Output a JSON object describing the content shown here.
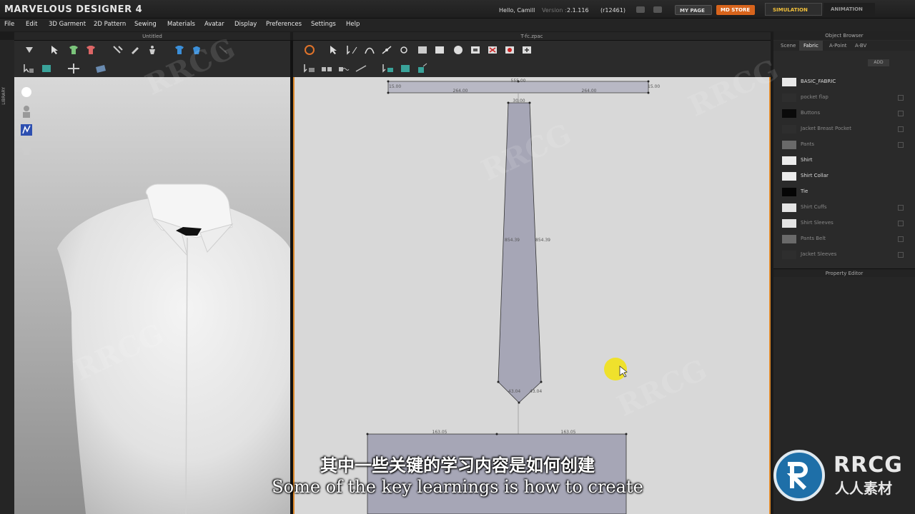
{
  "app": {
    "title": "MARVELOUS DESIGNER 4",
    "greeting": "Hello, Camill",
    "version_label": "Version :",
    "version": "2.1.116",
    "build": "(r12461)",
    "my_page": "MY PAGE",
    "md_store": "MD STORE",
    "simulation": "SIMULATION",
    "animation": "ANIMATION"
  },
  "menu": [
    "File",
    "Edit",
    "3D Garment",
    "2D Pattern",
    "Sewing",
    "Materials",
    "Avatar",
    "Display",
    "Preferences",
    "Settings",
    "Help"
  ],
  "left_strip_label": "LIBRARY",
  "view3d": {
    "title": "Untitled"
  },
  "view2d": {
    "title": "T-fc.zpac",
    "measurements": {
      "top_center": "555.00",
      "top_left_end": "15.00",
      "top_right_end": "15.00",
      "top_left": "264.00",
      "top_right": "264.00",
      "tie_top": "30.00",
      "tie_left": "854.39",
      "tie_right": "854.39",
      "tie_bottom_left": "43.04",
      "tie_bottom_right": "43.04",
      "bottom_left": "163.05",
      "bottom_right": "163.05"
    }
  },
  "object_browser": {
    "title": "Object Browser",
    "tabs": [
      "Scene",
      "Fabric",
      "A-Point",
      "A-BV"
    ],
    "active_tab": "Fabric",
    "add_label": "ADD",
    "fabrics": [
      {
        "name": "BASIC_FABRIC",
        "color": "#e8e8e8",
        "bright": true
      },
      {
        "name": "pocket flap",
        "color": "#2e2e2e",
        "bright": false
      },
      {
        "name": "Buttons",
        "color": "#0a0a0a",
        "bright": false
      },
      {
        "name": "Jacket Breast Pocket",
        "color": "#2e2e2e",
        "bright": false
      },
      {
        "name": "Pants",
        "color": "#6a6a6a",
        "bright": false
      },
      {
        "name": "Shirt",
        "color": "#ececec",
        "bright": true
      },
      {
        "name": "Shirt Collar",
        "color": "#ececec",
        "bright": true
      },
      {
        "name": "Tie",
        "color": "#050505",
        "bright": true
      },
      {
        "name": "Shirt Cuffs",
        "color": "#e4e4e4",
        "bright": false
      },
      {
        "name": "Shirt Sleeves",
        "color": "#e4e4e4",
        "bright": false
      },
      {
        "name": "Pants Belt",
        "color": "#6a6a6a",
        "bright": false
      },
      {
        "name": "Jacket Sleeves",
        "color": "#2e2e2e",
        "bright": false
      }
    ]
  },
  "property_editor": {
    "title": "Property Editor"
  },
  "subtitles": {
    "chinese": "其中一些关键的学习内容是如何创建",
    "english": "Some of the key learnings is how to create"
  },
  "watermark": {
    "text": "RRCG",
    "logo_text": "RRCG",
    "logo_sub": "人人素材"
  }
}
